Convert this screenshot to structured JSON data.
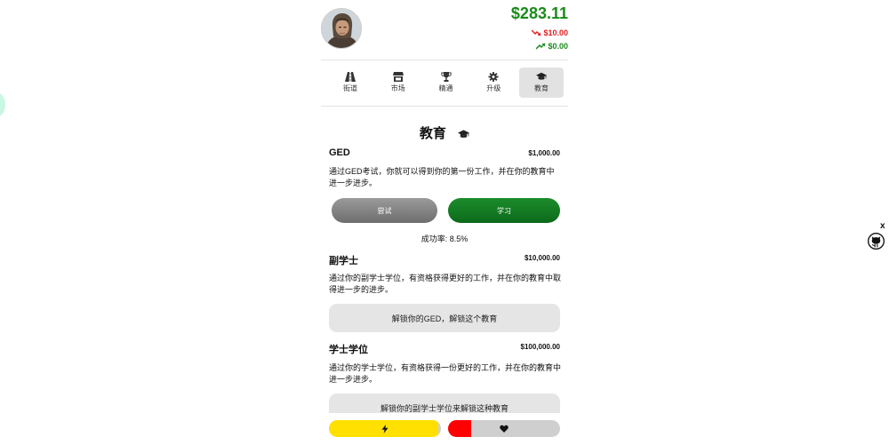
{
  "header": {
    "balance": "$283.11",
    "expense": "$10.00",
    "income": "$0.00"
  },
  "nav": {
    "items": [
      {
        "label": "街道",
        "icon": "road-icon"
      },
      {
        "label": "市场",
        "icon": "store-icon"
      },
      {
        "label": "精通",
        "icon": "trophy-icon"
      },
      {
        "label": "升级",
        "icon": "gear-icon"
      },
      {
        "label": "教育",
        "icon": "graduation-cap-icon",
        "active": true
      }
    ]
  },
  "section": {
    "title": "教育"
  },
  "courses": [
    {
      "name": "GED",
      "cost": "$1,000.00",
      "description": "通过GED考试，你就可以得到你的第一份工作，并在你的教育中进一步进步。",
      "try_label": "尝试",
      "study_label": "学习",
      "success_rate": "成功率: 8.5%"
    },
    {
      "name": "副学士",
      "cost": "$10,000.00",
      "description": "通过你的副学士学位，有资格获得更好的工作，并在你的教育中取得进一步的进步。",
      "locked_label": "解锁你的GED，解锁这个教育"
    },
    {
      "name": "学士学位",
      "cost": "$100,000.00",
      "description": "通过你的学士学位，有资格获得一份更好的工作，并在你的教育中进一步进步。",
      "locked_label": "解锁你的副学士学位来解锁这种教育"
    }
  ],
  "status": {
    "energy_level": 0.98,
    "energy_color": "#ffe000",
    "health_level": 0.21,
    "health_color": "#ff0000"
  },
  "widget": {
    "close_label": "x"
  }
}
